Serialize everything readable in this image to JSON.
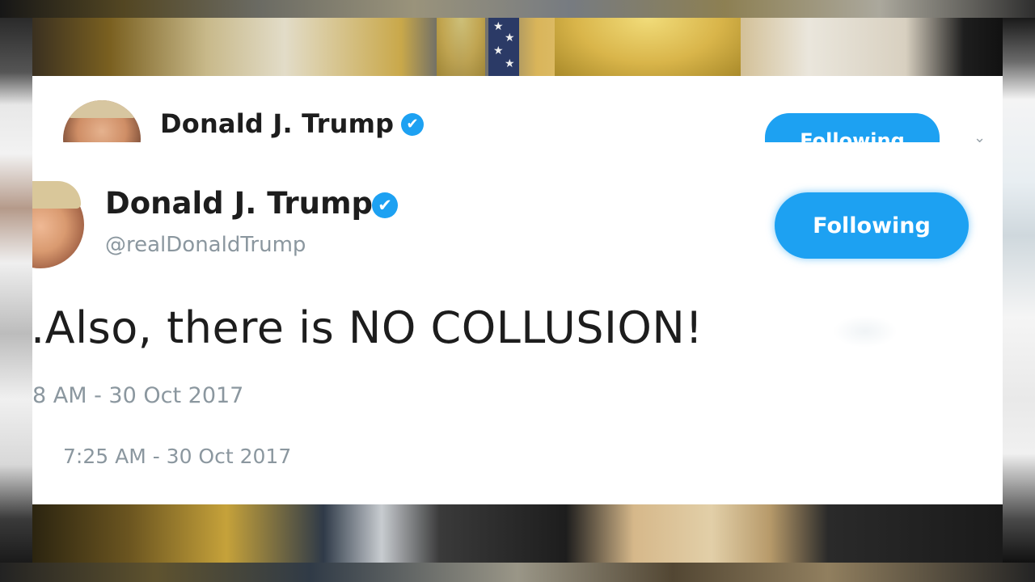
{
  "back_tweet": {
    "name": "Donald J. Trump",
    "verified_glyph": "✔",
    "follow_label": "Following",
    "caret": "⌄",
    "timestamp": "7:25 AM - 30 Oct 2017"
  },
  "front_tweet": {
    "name": "Donald J. Trump",
    "verified_glyph": "✔",
    "handle": "@realDonaldTrump",
    "follow_label": "Following",
    "text": ".Also, there is NO COLLUSION!",
    "timestamp": "8 AM - 30 Oct 2017"
  },
  "colors": {
    "accent": "#1da1f2",
    "name_text": "#1d1d1d",
    "muted_text": "#8b979f",
    "card_bg": "#ffffff"
  },
  "icons": {
    "verified": "verified-badge-icon",
    "caret": "chevron-down-icon",
    "flag_star": "star-icon"
  }
}
